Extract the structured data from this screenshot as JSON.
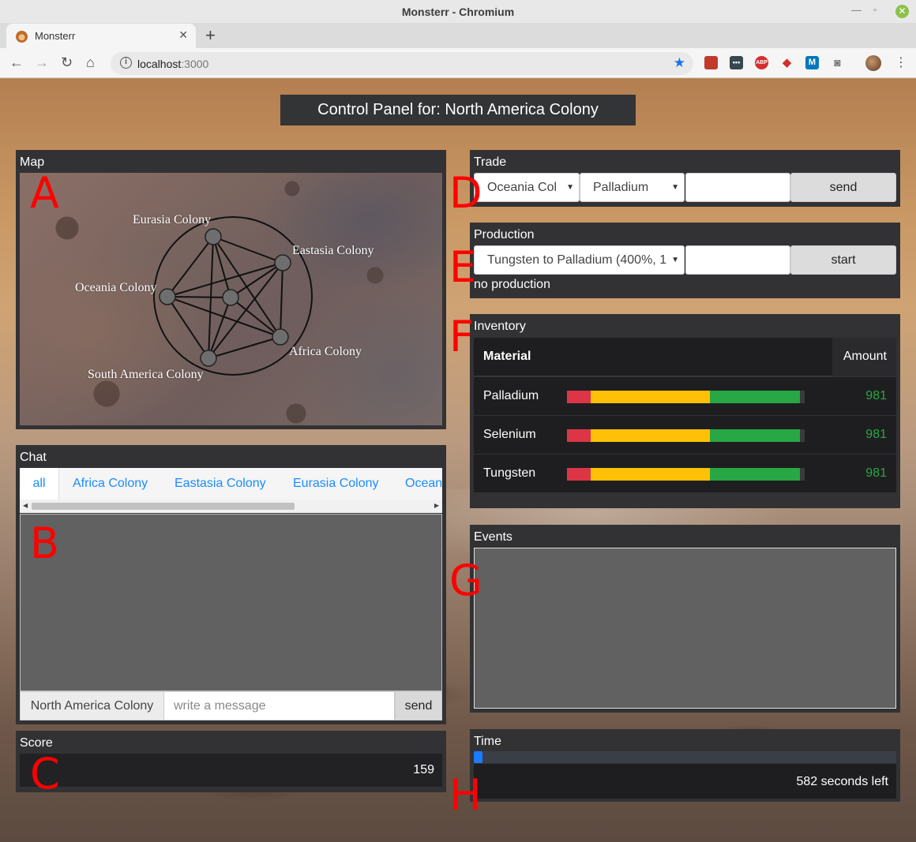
{
  "browser": {
    "window_title": "Monsterr - Chromium",
    "tab_title": "Monsterr",
    "url_host": "localhost",
    "url_port": ":3000"
  },
  "page": {
    "title": "Control Panel for: North America Colony"
  },
  "map": {
    "title": "Map",
    "letter": "A",
    "colonies": [
      "Eurasia Colony",
      "Eastasia Colony",
      "Oceania Colony",
      "Africa Colony",
      "South America Colony"
    ]
  },
  "chat": {
    "title": "Chat",
    "letter": "B",
    "tabs": [
      "all",
      "Africa Colony",
      "Eastasia Colony",
      "Eurasia Colony",
      "Ocean"
    ],
    "sender": "North America Colony",
    "placeholder": "write a message",
    "send_label": "send"
  },
  "score": {
    "title": "Score",
    "letter": "C",
    "value": "159"
  },
  "trade": {
    "title": "Trade",
    "letter": "D",
    "colony_select": "Oceania Col",
    "material_select": "Palladium",
    "send_label": "send"
  },
  "production": {
    "title": "Production",
    "letter": "E",
    "recipe_select": "Tungsten to Palladium (400%, 1",
    "start_label": "start",
    "status": "no production"
  },
  "inventory": {
    "title": "Inventory",
    "letter": "F",
    "col_material": "Material",
    "col_amount": "Amount",
    "segment_colors": [
      "#dc3545",
      "#ffc107",
      "#28a745"
    ],
    "rows": [
      {
        "name": "Palladium",
        "amount": "981"
      },
      {
        "name": "Selenium",
        "amount": "981"
      },
      {
        "name": "Tungsten",
        "amount": "981"
      }
    ]
  },
  "events": {
    "title": "Events",
    "letter": "G"
  },
  "time": {
    "title": "Time",
    "letter": "H",
    "progress": 0.02,
    "remaining": "582 seconds left"
  }
}
